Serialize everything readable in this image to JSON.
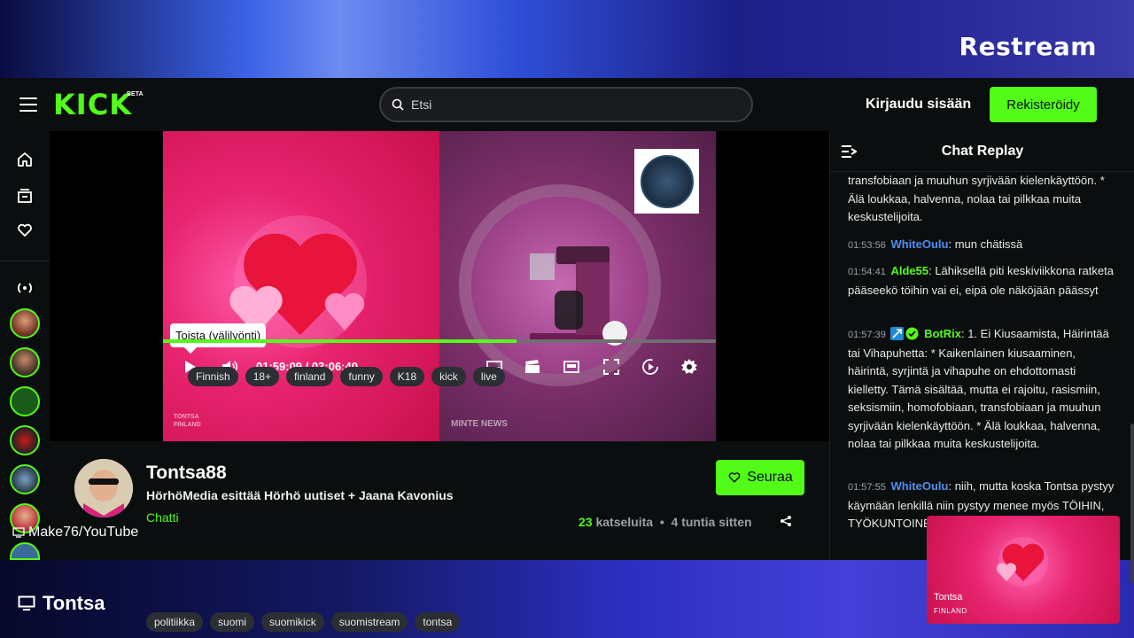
{
  "overlay": {
    "brand": "Restream",
    "credit": "Make76/YouTube",
    "bottom_title": "Tontsa"
  },
  "header": {
    "logo": "KICK",
    "logo_badge": "BETA",
    "search_placeholder": "Etsi",
    "login_label": "Kirjaudu sisään",
    "register_label": "Rekisteröidy"
  },
  "sidebar": {
    "icons": [
      "home-icon",
      "browse-icon",
      "following-icon",
      "live-channels-icon"
    ]
  },
  "player": {
    "tooltip": "Toista (välilyönti)",
    "current_time": "01:59:09",
    "separator": "/",
    "duration": "03:06:40",
    "progress_fraction": 0.64,
    "watermark_left": "TONTSA",
    "watermark_left_sub": "FINLAND",
    "watermark_center": "MINTE NEWS",
    "accent": "#53fc18"
  },
  "channel": {
    "name": "Tontsa88",
    "stream_title": "HörhöMedia esittää Hörhö uutiset + Jaana Kavonius",
    "category": "Chatti",
    "tags_row1": [
      "Finnish",
      "18+",
      "finland",
      "funny",
      "K18",
      "kick",
      "live"
    ],
    "tags_row2": [
      "politiikka",
      "suomi",
      "suomikick",
      "suomistream",
      "tontsa"
    ],
    "follow_label": "Seuraa",
    "viewer_count": "23",
    "viewer_label": "katseluita",
    "dot": "•",
    "time_ago": "4 tuntia sitten"
  },
  "chat": {
    "title": "Chat Replay",
    "messages": [
      {
        "time": "",
        "user": "",
        "text": "transfobiaan ja muuhun syrjivään kielenkäyttöön. * Älä loukkaa, halvenna, nolaa tai pilkkaa muita keskustelijoita."
      },
      {
        "time": "01:53:56",
        "user": "WhiteOulu",
        "text": "mun chätissä"
      },
      {
        "time": "01:54:41",
        "user": "Alde55",
        "text": "Lähiksellä piti keskiviikkona ratketa pääseekö töihin vai ei, eipä ole näköjään päässyt"
      },
      {
        "time": "01:57:39",
        "user": "BotRix",
        "text": "1. Ei Kiusaamista, Häirintää tai Vihapuhetta: * Kaikenlainen kiusaaminen, häirintä, syrjintä ja vihapuhe on ehdottomasti kielletty. Tämä sisältää, mutta ei rajoitu, rasismiin, seksismiin, homofobiaan, transfobiaan ja muuhun syrjivään kielenkäyttöön. * Älä loukkaa, halvenna, nolaa tai pilkkaa muita keskustelijoita."
      },
      {
        "time": "01:57:55",
        "user": "WhiteOulu",
        "text": "niih, mutta koska Tontsa pystyy käymään lenkillä niin pystyy menee myös TÖIHIN, ",
        "text2": "TYÖKUNTOINE"
      }
    ]
  },
  "pip": {
    "name": "Tontsa",
    "sub": "FINLAND"
  }
}
